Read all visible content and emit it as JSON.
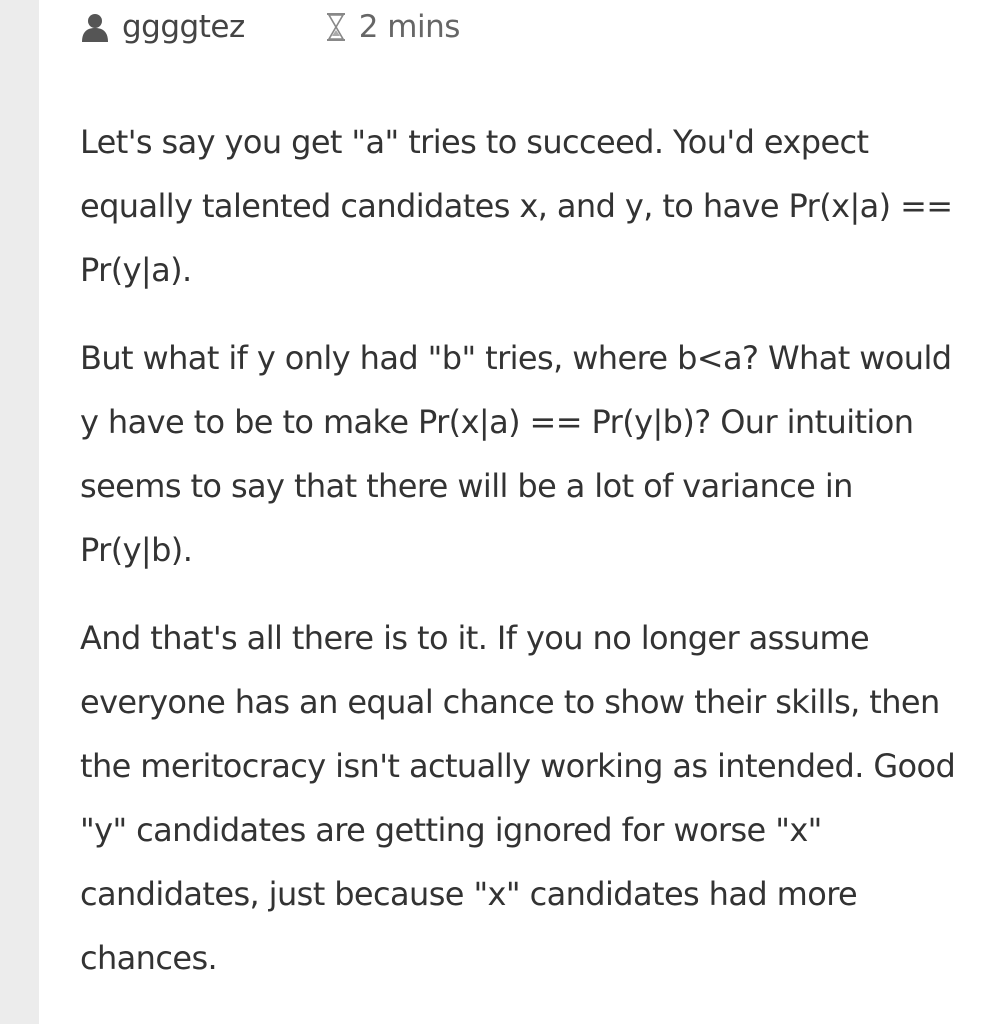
{
  "comment": {
    "author": "ggggtez",
    "author_icon": "user-icon",
    "timestamp": "2 mins",
    "timestamp_icon": "hourglass-icon",
    "paragraphs": [
      "Let's say you get \"a\" tries to succeed. You'd expect equally talented candidates x, and y, to have Pr(x|a) == Pr(y|a).",
      "But what if y only had \"b\" tries, where b<a? What would y have to be to make Pr(x|a) == Pr(y|b)? Our intuition seems to say that there will be a lot of variance in Pr(y|b).",
      "And that's all there is to it. If you no longer assume everyone has an equal chance to show their skills, then the meritocracy isn't actually working as intended. Good \"y\" candidates are getting ignored for worse \"x\" candidates, just because \"x\" candidates had more chances."
    ]
  },
  "colors": {
    "rail": "#ececec",
    "text": "#333333",
    "meta": "#555555"
  }
}
